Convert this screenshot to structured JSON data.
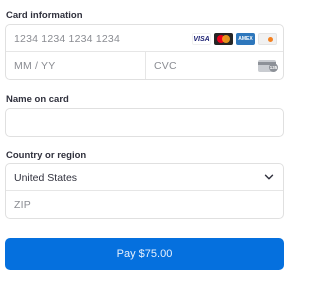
{
  "card": {
    "label": "Card information",
    "number_placeholder": "1234 1234 1234 1234",
    "expiry_placeholder": "MM / YY",
    "cvc_placeholder": "CVC",
    "brands": [
      "visa",
      "mastercard",
      "amex",
      "discover"
    ],
    "visa_text": "VISA",
    "amex_text": "AMEX",
    "discover_text": "DISCOVER",
    "cvc_icon_text": "135"
  },
  "name": {
    "label": "Name on card",
    "value": ""
  },
  "country": {
    "label": "Country or region",
    "selected": "United States",
    "zip_placeholder": "ZIP"
  },
  "pay_button": {
    "label": "Pay $75.00"
  },
  "colors": {
    "accent": "#0570de",
    "text": "#30313d",
    "placeholder": "#8a8c92",
    "border": "#e0e0e0"
  }
}
